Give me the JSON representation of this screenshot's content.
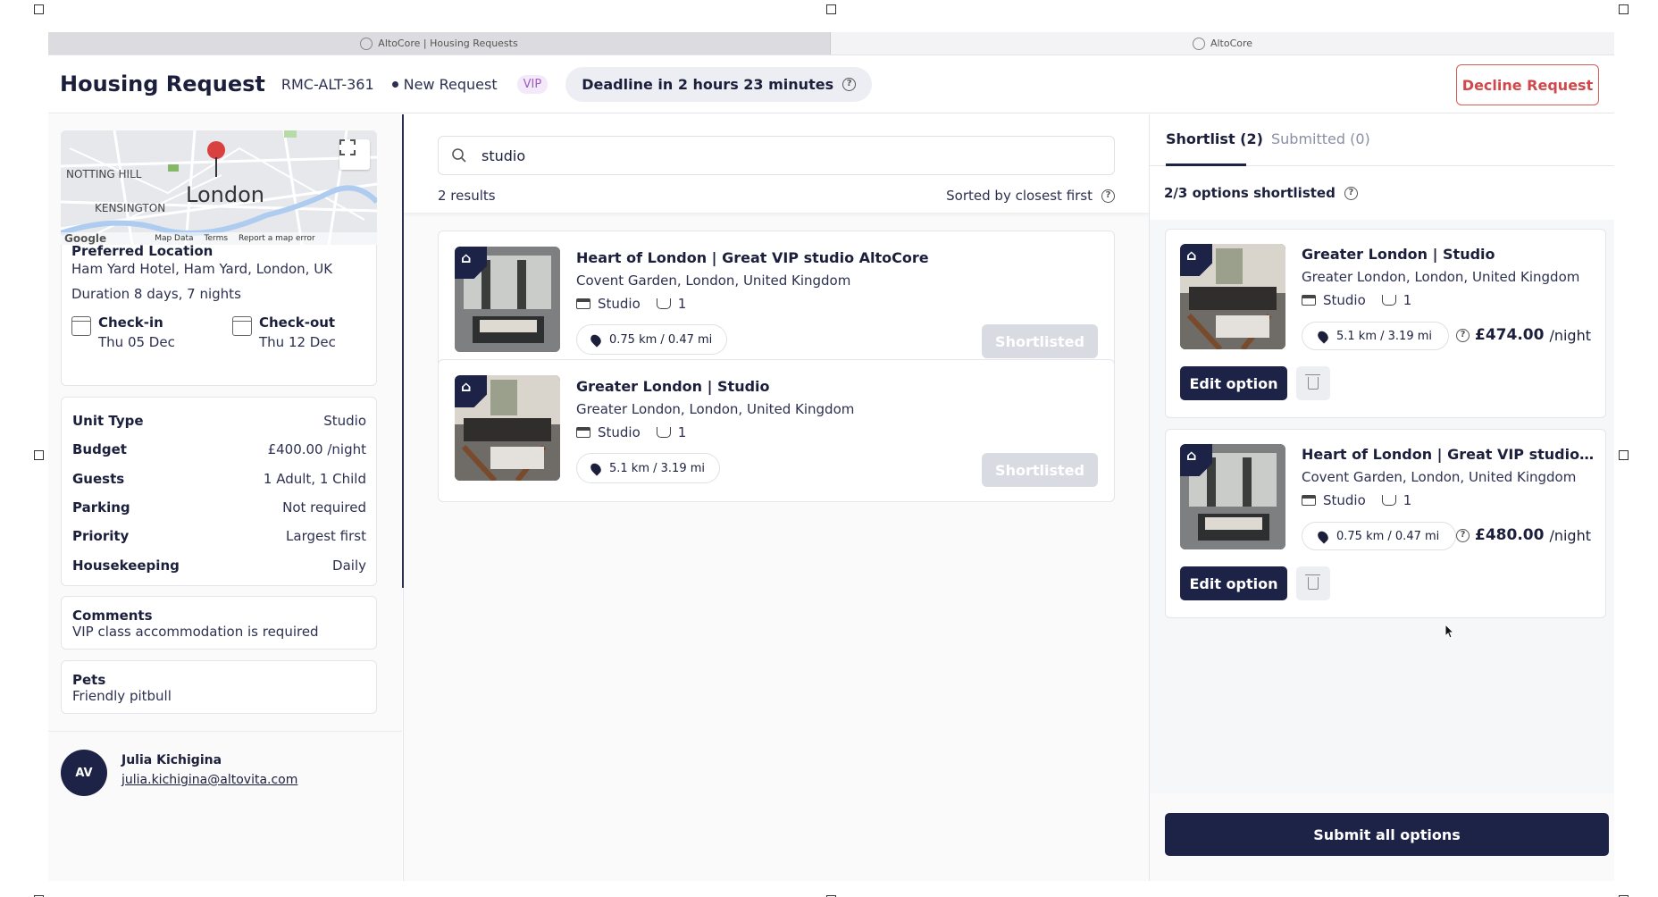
{
  "browser_tabs": [
    {
      "title": "AltoCore | Housing Requests"
    },
    {
      "title": "AltoCore"
    }
  ],
  "header": {
    "title": "Housing Request",
    "request_id": "RMC-ALT-361",
    "status": "New Request",
    "vip_badge": "VIP",
    "deadline": "Deadline in 2 hours 23 minutes",
    "decline_label": "Decline Request"
  },
  "map": {
    "label_city": "London",
    "label_nh1": "NOTTING HILL",
    "label_nh2": "KENSINGTON",
    "footer_google": "Google",
    "footer_data": "Map Data",
    "footer_terms": "Terms",
    "footer_report": "Report a map error"
  },
  "location": {
    "heading": "Preferred Location",
    "address": "Ham Yard Hotel, Ham Yard, London, UK",
    "duration": "Duration 8 days, 7 nights",
    "checkin_label": "Check-in",
    "checkin_date": "Thu 05 Dec",
    "checkout_label": "Check-out",
    "checkout_date": "Thu 12 Dec"
  },
  "details": [
    {
      "k": "Unit Type",
      "v": "Studio"
    },
    {
      "k": "Budget",
      "v": "£400.00 /night"
    },
    {
      "k": "Guests",
      "v": "1 Adult, 1 Child"
    },
    {
      "k": "Parking",
      "v": "Not required"
    },
    {
      "k": "Priority",
      "v": "Largest first"
    },
    {
      "k": "Housekeeping",
      "v": "Daily"
    }
  ],
  "comments": {
    "heading": "Comments",
    "text": "VIP class accommodation is required"
  },
  "pets": {
    "heading": "Pets",
    "text": "Friendly pitbull"
  },
  "user": {
    "initials": "AV",
    "name": "Julia Kichigina",
    "email": "julia.kichigina@altovita.com"
  },
  "search": {
    "value": "studio"
  },
  "results": {
    "count": "2 results",
    "sort": "Sorted by closest first",
    "items": [
      {
        "title": "Heart of London | Great VIP studio AltoCore",
        "address": "Covent Garden, London, United Kingdom",
        "unit": "Studio",
        "baths": "1",
        "distance": "0.75 km / 0.47 mi",
        "action": "Shortlisted"
      },
      {
        "title": "Greater London | Studio",
        "address": "Greater London, London, United Kingdom",
        "unit": "Studio",
        "baths": "1",
        "distance": "5.1 km / 3.19 mi",
        "action": "Shortlisted"
      }
    ]
  },
  "right_panel": {
    "tab_shortlist": "Shortlist (2)",
    "tab_submitted": "Submitted (0)",
    "shortlist_count": "2/3 options shortlisted",
    "options": [
      {
        "title": "Greater London | Studio",
        "address": "Greater London, London, United Kingdom",
        "unit": "Studio",
        "baths": "1",
        "distance": "5.1 km / 3.19 mi",
        "price": "£474.00",
        "price_unit": "/night",
        "edit": "Edit option"
      },
      {
        "title": "Heart of London | Great VIP studio AltoC...",
        "address": "Covent Garden, London, United Kingdom",
        "unit": "Studio",
        "baths": "1",
        "distance": "0.75 km / 0.47 mi",
        "price": "£480.00",
        "price_unit": "/night",
        "edit": "Edit option"
      }
    ],
    "submit_label": "Submit all options"
  },
  "colors": {
    "navy": "#1d2347",
    "decline": "#d0484b",
    "vip": "#9b5fc0"
  }
}
